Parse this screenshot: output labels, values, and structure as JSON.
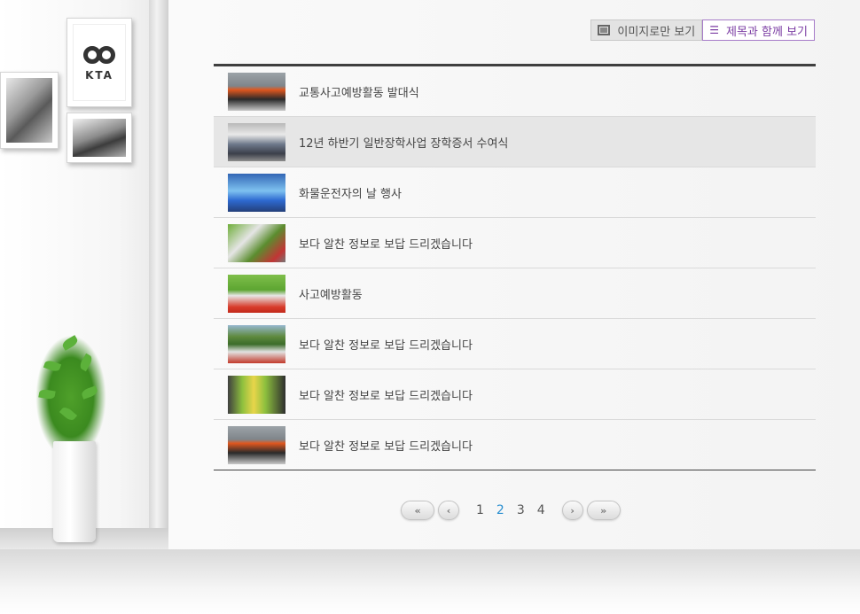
{
  "decor": {
    "logo_text": "KTA"
  },
  "view_toggle": {
    "image_only_label": "이미지로만 보기",
    "with_title_label": "제목과 함께 보기"
  },
  "board": {
    "items": [
      {
        "title": "교통사고예방활동 발대식",
        "active": false
      },
      {
        "title": "12년 하반기 일반장학사업 장학증서 수여식",
        "active": true
      },
      {
        "title": "화물운전자의 날 행사",
        "active": false
      },
      {
        "title": "보다 알찬 정보로 보답 드리겠습니다",
        "active": false
      },
      {
        "title": "사고예방활동",
        "active": false
      },
      {
        "title": "보다 알찬 정보로 보답 드리겠습니다",
        "active": false
      },
      {
        "title": "보다 알찬 정보로 보답 드리겠습니다",
        "active": false
      },
      {
        "title": "보다 알찬 정보로 보답 드리겠습니다",
        "active": false
      }
    ]
  },
  "pagination": {
    "first_icon": "double-chevron-left-icon",
    "prev_icon": "chevron-left-icon",
    "next_icon": "chevron-right-icon",
    "last_icon": "double-chevron-right-icon",
    "pages": [
      "1",
      "2",
      "3",
      "4"
    ],
    "current": "2",
    "current_color": "#2a8fd0"
  },
  "colors": {
    "accent": "#7b3ca3",
    "board_border": "#3f3f3f"
  }
}
